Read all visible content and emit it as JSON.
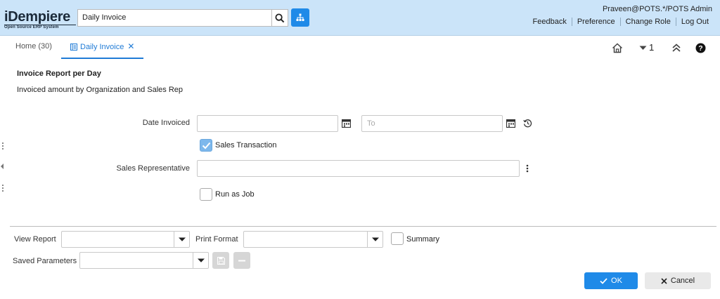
{
  "header": {
    "logo_main": "iDempiere",
    "logo_sub": "Open Source ERP System",
    "search_value": "Daily Invoice",
    "user": "Praveen@POTS.*/POTS Admin",
    "menu": [
      "Feedback",
      "Preference",
      "Change Role",
      "Log Out"
    ]
  },
  "tabs": {
    "home": "Home (30)",
    "active": "Daily Invoice",
    "window_count": "1"
  },
  "process": {
    "title": "Invoice Report per Day",
    "description": "Invoiced amount by Organization and Sales Rep"
  },
  "params": {
    "date_invoiced_label": "Date Invoiced",
    "date_from_value": "",
    "date_to_placeholder": "To",
    "sales_transaction_label": "Sales Transaction",
    "sales_transaction_checked": true,
    "sales_rep_label": "Sales Representative",
    "sales_rep_value": "",
    "run_as_job_label": "Run as Job",
    "run_as_job_checked": false
  },
  "footer": {
    "view_report_label": "View Report",
    "view_report_value": "",
    "print_format_label": "Print Format",
    "print_format_value": "",
    "summary_label": "Summary",
    "summary_checked": false,
    "saved_params_label": "Saved Parameters",
    "saved_params_value": "",
    "ok_label": "OK",
    "cancel_label": "Cancel"
  },
  "colors": {
    "header_bg": "#cbe4f9",
    "accent": "#1f8ae8",
    "checked": "#7db8ec"
  },
  "icons": [
    "search-icon",
    "tree-icon",
    "window-icon",
    "close-icon",
    "home-icon",
    "chevron-down-icon",
    "collapse-icon",
    "help-icon",
    "calendar-icon",
    "history-icon",
    "more-icon",
    "check-icon",
    "save-icon",
    "minus-icon"
  ]
}
